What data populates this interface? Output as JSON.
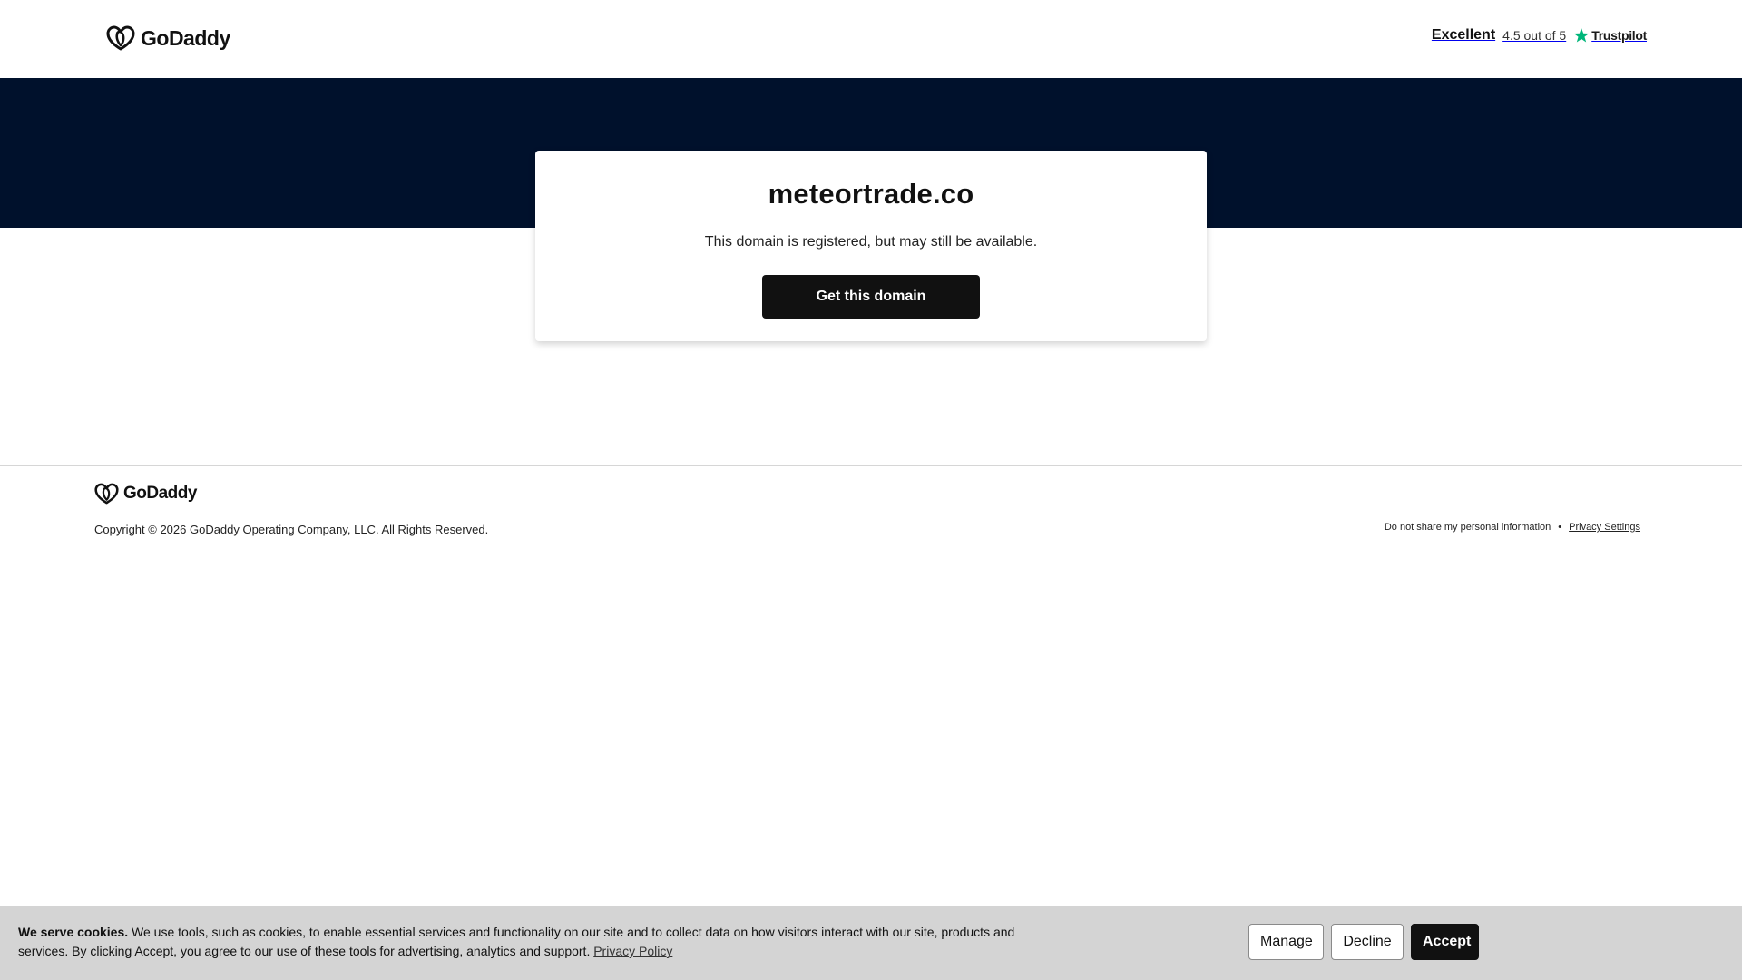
{
  "header": {
    "logo_text": "GoDaddy",
    "rating_word": "Excellent",
    "rating_score": "4.5 out of 5",
    "trustpilot_name": "Trustpilot",
    "trustpilot_color": "#00b67a"
  },
  "hero": {
    "background": "#00112c"
  },
  "card": {
    "domain": "meteortrade.co",
    "subtitle": "This domain is registered, but may still be available.",
    "cta_label": "Get this domain"
  },
  "footer": {
    "logo_text": "GoDaddy",
    "copyright": "Copyright © 2026 GoDaddy Operating Company, LLC. All Rights Reserved.",
    "optout_label": "Do not share my personal information",
    "separator": "•",
    "privacy_settings_label": "Privacy Settings"
  },
  "cookie_banner": {
    "lead": "We serve cookies.",
    "body": " We use tools, such as cookies, to enable essential services and functionality on our site and to collect data on how visitors interact with our site, products and services. By clicking Accept, you agree to our use of these tools for advertising, analytics and support. ",
    "privacy_link": "Privacy Policy",
    "manage_label": "Manage",
    "decline_label": "Decline",
    "accept_label": "Accept",
    "close_icon": "close-icon"
  }
}
